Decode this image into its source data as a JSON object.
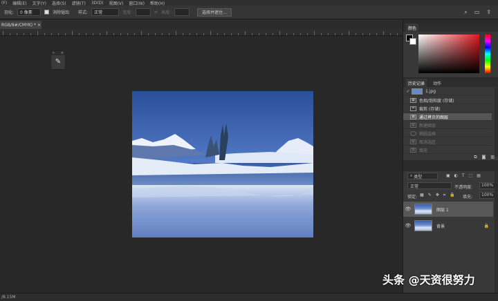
{
  "menu": [
    "(F)",
    "编辑(E)",
    "文字(Y)",
    "选择(S)",
    "滤镜(T)",
    "3D(D)",
    "视图(V)",
    "窗口(W)",
    "帮助(H)"
  ],
  "options": {
    "feather_label": "羽化:",
    "feather_value": "0 像素",
    "antialias_label": "消除锯齿",
    "style_label": "样式:",
    "style_value": "正常",
    "width_label": "宽度:",
    "height_label": "高度:",
    "select_mask_btn": "选择并遮住..."
  },
  "doc_tab": "RGB/8#/CMYK) * ×",
  "tool_panel": {
    "icon": "eyedropper-icon"
  },
  "color_panel": {
    "tab": "颜色"
  },
  "history_panel": {
    "tabs": [
      "历史记录",
      "动作"
    ],
    "items": [
      {
        "label": "1.jpg",
        "state": "normal"
      },
      {
        "label": "色相/饱和度 (存储)",
        "state": "normal"
      },
      {
        "label": "裁剪 (存储)",
        "state": "normal"
      },
      {
        "label": "通过拷贝的图层",
        "state": "selected"
      },
      {
        "label": "新建图层",
        "state": "dim"
      },
      {
        "label": "椭圆选框",
        "state": "dim"
      },
      {
        "label": "取消选区",
        "state": "dim"
      },
      {
        "label": "填充",
        "state": "dim"
      }
    ]
  },
  "layers_panel": {
    "filter_label": "类型",
    "blend_mode": "正常",
    "opacity_label": "不透明度:",
    "opacity_value": "100%",
    "lock_label": "锁定:",
    "fill_label": "填充:",
    "fill_value": "100%",
    "layers": [
      {
        "name": "图层 1",
        "selected": true
      },
      {
        "name": "背景",
        "selected": false
      }
    ]
  },
  "status": {
    "left": "/8.15M"
  },
  "watermark": "头条 @天资很努力"
}
